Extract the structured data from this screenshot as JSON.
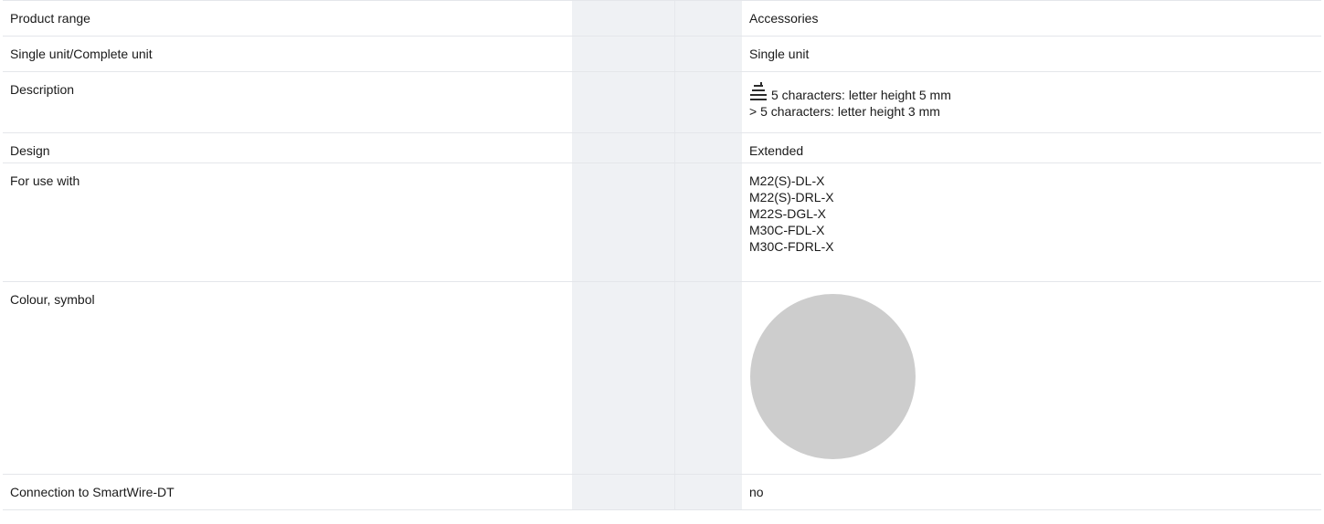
{
  "rows": [
    {
      "label": "Product range",
      "value": "Accessories"
    },
    {
      "label": "Single unit/Complete unit",
      "value": "Single unit"
    },
    {
      "label": "Description",
      "value_lines": [
        "5 characters: letter height 5 mm",
        "> 5 characters: letter height 3 mm"
      ],
      "icon": "font-size-icon"
    },
    {
      "label": "Design",
      "value": "Extended"
    },
    {
      "label": "For use with",
      "value_lines": [
        "M22(S)-DL-X",
        "M22(S)-DRL-X",
        "M22S-DGL-X",
        "M30C-FDL-X",
        "M30C-FDRL-X"
      ]
    },
    {
      "label": "Colour, symbol",
      "swatch_color": "#cdcdcd",
      "swatch_shape": "circle"
    },
    {
      "label": "Connection to SmartWire-DT",
      "value": "no"
    }
  ],
  "colors": {
    "gap_column": "#eff1f4",
    "row_divider": "#e4e6ea"
  }
}
